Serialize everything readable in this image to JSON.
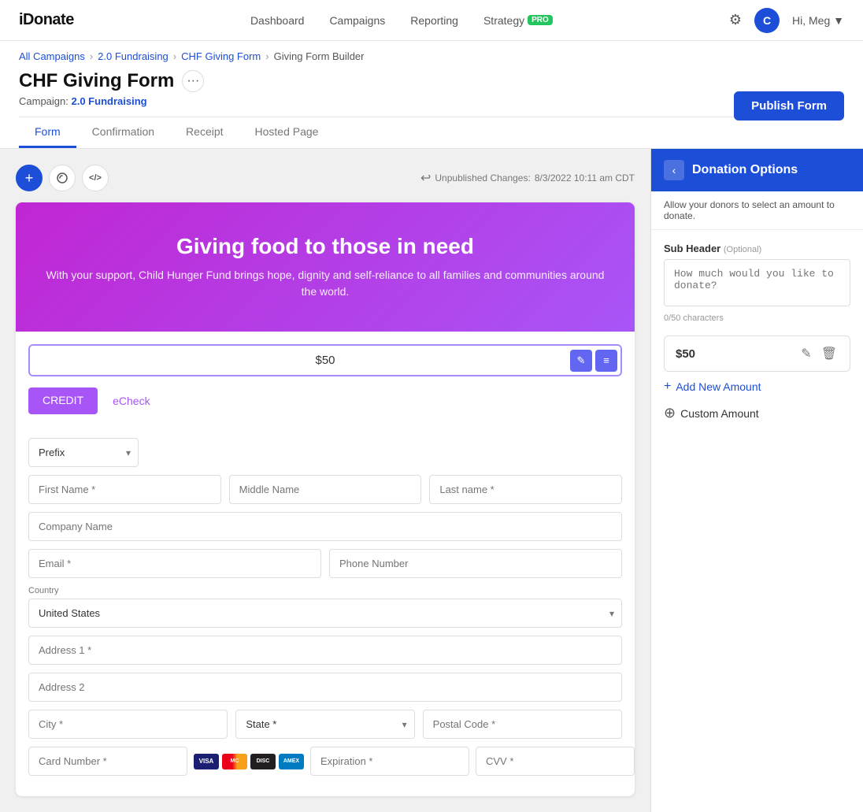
{
  "brand": {
    "logo": "iDonate"
  },
  "nav": {
    "links": [
      "Dashboard",
      "Campaigns",
      "Reporting"
    ],
    "strategy": "Strategy",
    "pro_badge": "PRO",
    "user_initial": "C",
    "user_greeting": "Hi, Meg",
    "user_dropdown": "▼"
  },
  "breadcrumb": {
    "items": [
      "All Campaigns",
      "2.0 Fundraising",
      "CHF Giving Form",
      "Giving Form Builder"
    ]
  },
  "page": {
    "title": "CHF Giving Form",
    "campaign_label": "Campaign:",
    "campaign_name": "2.0 Fundraising"
  },
  "publish_btn": "Publish Form",
  "tabs": [
    "Form",
    "Confirmation",
    "Receipt",
    "Hosted Page"
  ],
  "active_tab": "Form",
  "toolbar": {
    "add_label": "+",
    "design_label": "✦",
    "code_label": "</>",
    "unpublished": "Unpublished Changes:",
    "timestamp": "8/3/2022 10:11 am CDT"
  },
  "form_preview": {
    "hero_title": "Giving food to those in need",
    "hero_subtitle": "With your support, Child Hunger Fund brings hope, dignity and self-reliance to all families and communities around the world.",
    "amount": "$50",
    "payment_tabs": [
      "CREDIT",
      "eCheck"
    ],
    "active_payment": "CREDIT",
    "fields": {
      "prefix": "Prefix",
      "first_name": "First Name *",
      "middle_name": "Middle Name",
      "last_name": "Last name *",
      "company_name": "Company Name",
      "email": "Email *",
      "phone": "Phone Number",
      "country_label": "Country",
      "country": "United States",
      "address1": "Address 1 *",
      "address2": "Address 2",
      "city": "City *",
      "state": "State *",
      "postal": "Postal Code *",
      "card_number": "Card Number *",
      "expiration": "Expiration *",
      "cvv": "CVV *"
    }
  },
  "donation_options": {
    "title": "Donation Options",
    "subtitle": "Allow your donors to select an amount to donate.",
    "sub_header_label": "Sub Header",
    "optional_tag": "(Optional)",
    "sub_header_placeholder": "How much would you like to donate?",
    "char_count": "0/50 characters",
    "amount_value": "$50",
    "add_amount": "Add New Amount",
    "custom_amount": "Custom Amount"
  }
}
